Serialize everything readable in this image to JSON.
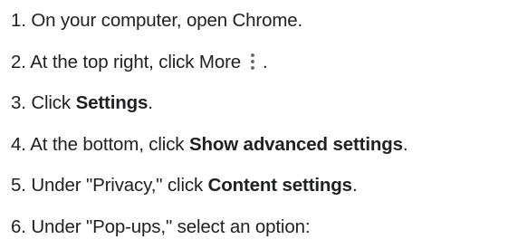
{
  "steps": [
    {
      "number": "1.",
      "text": "On your computer, open Chrome."
    },
    {
      "number": "2.",
      "text_before": "At the top right, click More",
      "icon": "more-vert-icon",
      "text_after": "."
    },
    {
      "number": "3.",
      "text_before": "Click",
      "bold": "Settings",
      "text_after": "."
    },
    {
      "number": "4.",
      "text_before": "At the bottom, click",
      "bold": "Show advanced settings",
      "text_after": "."
    },
    {
      "number": "5.",
      "text_before": "Under \"Privacy,\" click",
      "bold": "Content settings",
      "text_after": "."
    },
    {
      "number": "6.",
      "text": "Under \"Pop-ups,\" select an option:"
    }
  ],
  "colors": {
    "text": "#202124",
    "icon": "#5f6368"
  }
}
